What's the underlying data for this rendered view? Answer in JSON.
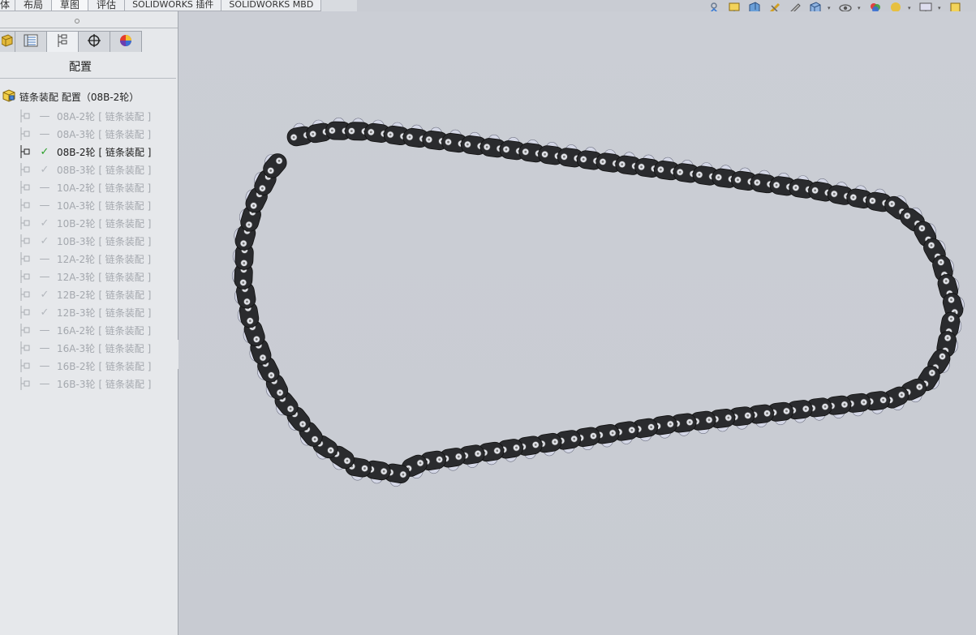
{
  "tabs": [
    {
      "label": "体",
      "active": false
    },
    {
      "label": "布局",
      "active": false
    },
    {
      "label": "草图",
      "active": true
    },
    {
      "label": "评估",
      "active": false
    },
    {
      "label": "SOLIDWORKS 插件",
      "active": false
    },
    {
      "label": "SOLIDWORKS MBD",
      "active": false
    }
  ],
  "panel": {
    "tool_tabs": [
      {
        "icon": "feature-manager-icon"
      },
      {
        "icon": "property-manager-icon"
      },
      {
        "icon": "configuration-manager-icon",
        "active": true
      },
      {
        "icon": "dimxpert-icon"
      },
      {
        "icon": "display-manager-icon"
      }
    ],
    "title": "配置",
    "root": {
      "label": "链条装配 配置（08B-2轮）"
    },
    "configs": [
      {
        "name": "08A-2轮",
        "tag": "[ 链条装配 ]",
        "mark": "dash"
      },
      {
        "name": "08A-3轮",
        "tag": "[ 链条装配 ]",
        "mark": "dash"
      },
      {
        "name": "08B-2轮",
        "tag": "[ 链条装配 ]",
        "mark": "check",
        "active": true
      },
      {
        "name": "08B-3轮",
        "tag": "[ 链条装配 ]",
        "mark": "check"
      },
      {
        "name": "10A-2轮",
        "tag": "[ 链条装配 ]",
        "mark": "dash"
      },
      {
        "name": "10A-3轮",
        "tag": "[ 链条装配 ]",
        "mark": "dash"
      },
      {
        "name": "10B-2轮",
        "tag": "[ 链条装配 ]",
        "mark": "check"
      },
      {
        "name": "10B-3轮",
        "tag": "[ 链条装配 ]",
        "mark": "check"
      },
      {
        "name": "12A-2轮",
        "tag": "[ 链条装配 ]",
        "mark": "dash"
      },
      {
        "name": "12A-3轮",
        "tag": "[ 链条装配 ]",
        "mark": "dash"
      },
      {
        "name": "12B-2轮",
        "tag": "[ 链条装配 ]",
        "mark": "check"
      },
      {
        "name": "12B-3轮",
        "tag": "[ 链条装配 ]",
        "mark": "check"
      },
      {
        "name": "16A-2轮",
        "tag": "[ 链条装配 ]",
        "mark": "dash"
      },
      {
        "name": "16A-3轮",
        "tag": "[ 链条装配 ]",
        "mark": "dash"
      },
      {
        "name": "16B-2轮",
        "tag": "[ 链条装配 ]",
        "mark": "dash"
      },
      {
        "name": "16B-3轮",
        "tag": "[ 链条装配 ]",
        "mark": "dash"
      }
    ]
  },
  "toolbar": {
    "icons": [
      "view-orientation-icon",
      "previous-view-icon",
      "section-view-icon",
      "dynamic-annotation-icon",
      "view-setting-icon",
      "display-style-icon",
      "hide-show-icon",
      "edit-appearance-icon",
      "apply-scene-icon",
      "monitor-icon",
      "view-tools-icon"
    ]
  },
  "viewport": {
    "model": "roller-chain-loop",
    "colors": {
      "link": "#2a2b2e",
      "roller": "#d4d7e6",
      "pin": "#e0e2e8",
      "background": "#c9ccd3"
    }
  }
}
